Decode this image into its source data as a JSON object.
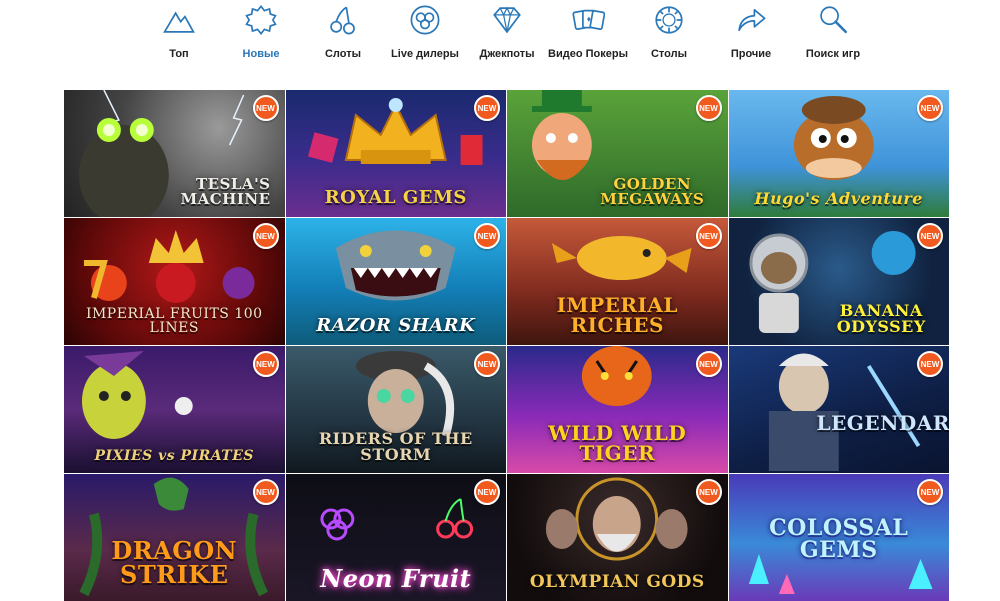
{
  "nav": {
    "accent_color": "#2a78b8",
    "items": [
      {
        "label": "Топ",
        "icon": "mountain-icon"
      },
      {
        "label": "Новые",
        "icon": "star-badge-icon",
        "active": true
      },
      {
        "label": "Слоты",
        "icon": "cherries-icon"
      },
      {
        "label": "Live дилеры",
        "icon": "chip-clover-icon"
      },
      {
        "label": "Джекпоты",
        "icon": "diamond-icon"
      },
      {
        "label": "Видео Покеры",
        "icon": "cards-icon"
      },
      {
        "label": "Столы",
        "icon": "casino-chip-icon"
      },
      {
        "label": "Прочие",
        "icon": "share-arrow-icon"
      },
      {
        "label": "Поиск игр",
        "icon": "search-icon"
      }
    ]
  },
  "badge_label": "NEW",
  "badge_color": "#f05a1f",
  "games": [
    {
      "title": "TESLA'S MACHINE",
      "theme": "tesla"
    },
    {
      "title": "ROYAL GEMS",
      "theme": "royal"
    },
    {
      "title": "GOLDEN MEGAWAYS",
      "theme": "leprechaun"
    },
    {
      "title": "Hugo's Adventure",
      "theme": "hugo"
    },
    {
      "title": "IMPERIAL FRUITS 100 LINES",
      "theme": "imperial"
    },
    {
      "title": "RAZOR SHARK",
      "theme": "shark"
    },
    {
      "title": "IMPERIAL RICHES",
      "theme": "riches"
    },
    {
      "title": "BANANA ODYSSEY",
      "theme": "banana"
    },
    {
      "title": "PIXIES vs PIRATES",
      "theme": "pixies"
    },
    {
      "title": "RIDERS OF THE STORM",
      "theme": "riders"
    },
    {
      "title": "WILD WILD TIGER",
      "theme": "tiger"
    },
    {
      "title": "LEGENDARY",
      "theme": "legendary"
    },
    {
      "title": "DRAGON STRIKE",
      "theme": "dragon"
    },
    {
      "title": "Neon Fruit",
      "theme": "neon"
    },
    {
      "title": "OLYMPIAN GODS",
      "theme": "olympian"
    },
    {
      "title": "COLOSSAL GEMS",
      "theme": "colossal"
    }
  ]
}
